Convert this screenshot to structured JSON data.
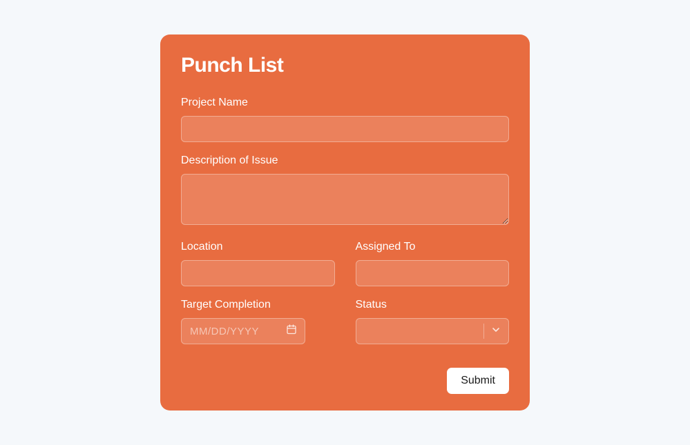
{
  "form": {
    "title": "Punch List",
    "project_name": {
      "label": "Project Name",
      "value": ""
    },
    "description": {
      "label": "Description of Issue",
      "value": ""
    },
    "location": {
      "label": "Location",
      "value": ""
    },
    "assigned_to": {
      "label": "Assigned To",
      "value": ""
    },
    "target_completion": {
      "label": "Target Completion",
      "placeholder": "MM/DD/YYYY",
      "value": ""
    },
    "status": {
      "label": "Status",
      "value": ""
    },
    "submit_label": "Submit"
  }
}
